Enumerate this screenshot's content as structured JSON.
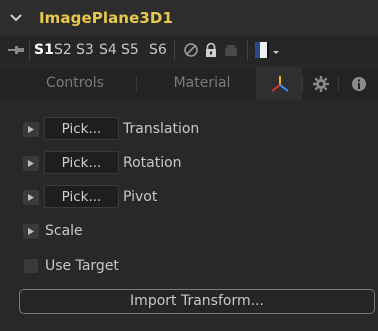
{
  "header": {
    "title": "ImagePlane3D1"
  },
  "toolbar": {
    "versions": [
      "S1",
      "S2",
      "S3",
      "S4",
      "S5",
      "S6"
    ],
    "active_version": "S1"
  },
  "tabs": {
    "controls": "Controls",
    "material": "Material"
  },
  "transform": {
    "pick_label": "Pick...",
    "translation": "Translation",
    "rotation": "Rotation",
    "pivot": "Pivot",
    "scale": "Scale",
    "use_target": "Use Target",
    "import_transform": "Import Transform..."
  },
  "colors": {
    "title": "#e8c84a",
    "active_tab_icon_x": "#e03030",
    "active_tab_icon_y": "#f0b020",
    "active_tab_icon_z": "#3a8ff0"
  }
}
